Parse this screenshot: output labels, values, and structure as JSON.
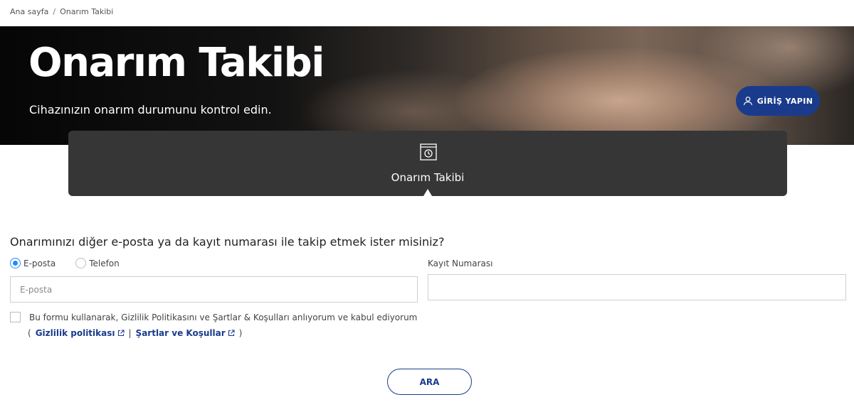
{
  "breadcrumb": {
    "home": "Ana sayfa",
    "separator": "/",
    "current": "Onarım Takibi"
  },
  "hero": {
    "title": "Onarım Takibi",
    "subtitle": "Cihazınızın onarım durumunu kontrol edin."
  },
  "login": {
    "label": "GİRİŞ YAPIN",
    "icon": "user-icon"
  },
  "tabs": [
    {
      "label": "Onarım Takibi",
      "icon": "repair-tracking-icon",
      "active": true
    }
  ],
  "form": {
    "question": "Onarımınızı diğer e-posta ya da kayıt numarası ile takip etmek ister misiniz?",
    "radio_options": [
      {
        "label": "E-posta",
        "checked": true
      },
      {
        "label": "Telefon",
        "checked": false
      }
    ],
    "email_placeholder": "E-posta",
    "email_value": "",
    "registration_label": "Kayıt Numarası",
    "registration_value": "",
    "consent_text": "Bu formu kullanarak, Gizlilik Politikasını ve Şartlar & Koşulları anlıyorum ve kabul ediyorum",
    "consent_checked": false,
    "links": {
      "open_paren": "(",
      "privacy": "Gizlilik politikası",
      "divider": "|",
      "terms": "Şartlar ve Koşullar",
      "close_paren": ")"
    },
    "search_button": "ARA"
  },
  "colors": {
    "brand_blue": "#1a3b8c",
    "radio_accent": "#2189ff",
    "tab_bg": "#363636"
  }
}
